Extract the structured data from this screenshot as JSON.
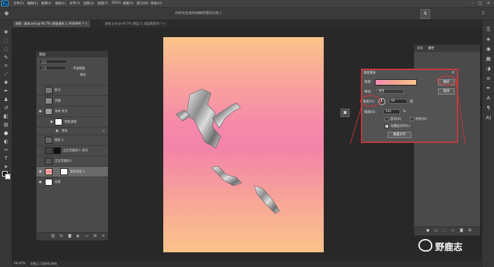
{
  "app": {
    "name": "Ps"
  },
  "menu": [
    "文件(F)",
    "编辑(E)",
    "图像(I)",
    "图层(L)",
    "文字(Y)",
    "选择(S)",
    "滤镜(T)",
    "3D(D)",
    "视图(V)",
    "窗口(W)",
    "帮助(H)"
  ],
  "doc_title": "你好先生给你讲解智慧的过程:)",
  "tabs": [
    {
      "label": "底版 - 副本.psd @ 66.7% (渐变填充 1, RGB/8#) *",
      "active": true
    },
    {
      "label": "底版.psd @ 66.7% (图层 1, 图层蒙版/8) *",
      "active": false
    }
  ],
  "layers_panel": {
    "title": "图层",
    "kind_filter": "类型",
    "blend_mode": "正常",
    "opacity_label": "不透明度:",
    "fill_label": "填充:",
    "layers": [
      {
        "name": "影子",
        "visible": false
      },
      {
        "name": "衣服",
        "visible": false
      },
      {
        "name": "身体 拷贝",
        "visible": true,
        "fx": true
      },
      {
        "name": "智能滤镜",
        "visible": true,
        "sub": true
      },
      {
        "name": "液化",
        "visible": true,
        "sub": true
      },
      {
        "name": "图层 2",
        "visible": false
      },
      {
        "name": "正在奔跑的人 拷贝",
        "visible": false
      },
      {
        "name": "正在奔跑的人",
        "visible": false
      },
      {
        "name": "渐变填充 1",
        "visible": true,
        "selected": true
      },
      {
        "name": "背景",
        "visible": true
      }
    ]
  },
  "right_panel": {
    "tabs": [
      "通道",
      "路径"
    ]
  },
  "dialog": {
    "title": "渐变填充",
    "gradient_label": "渐变:",
    "style_label": "样式:",
    "style_value": "线性",
    "angle_label": "角度(A):",
    "angle_value": "90",
    "angle_unit": "度",
    "scale_label": "缩放(S):",
    "scale_value": "100",
    "scale_unit": "%",
    "reverse_label": "反向(R)",
    "dither_label": "仿色(D)",
    "align_label": "与图层对齐(L)",
    "reset_label": "重置对齐",
    "ok_label": "确定",
    "cancel_label": "取消",
    "reverse_checked": false,
    "dither_checked": false,
    "align_checked": true
  },
  "status": {
    "zoom": "66.67%",
    "doc": "文档:2.75M/9.09M"
  },
  "watermark": {
    "text": "野鹿志"
  },
  "colors": {
    "annotation": "#e23333",
    "canvas_top": "#fbc58a",
    "canvas_mid": "#f384a9"
  }
}
